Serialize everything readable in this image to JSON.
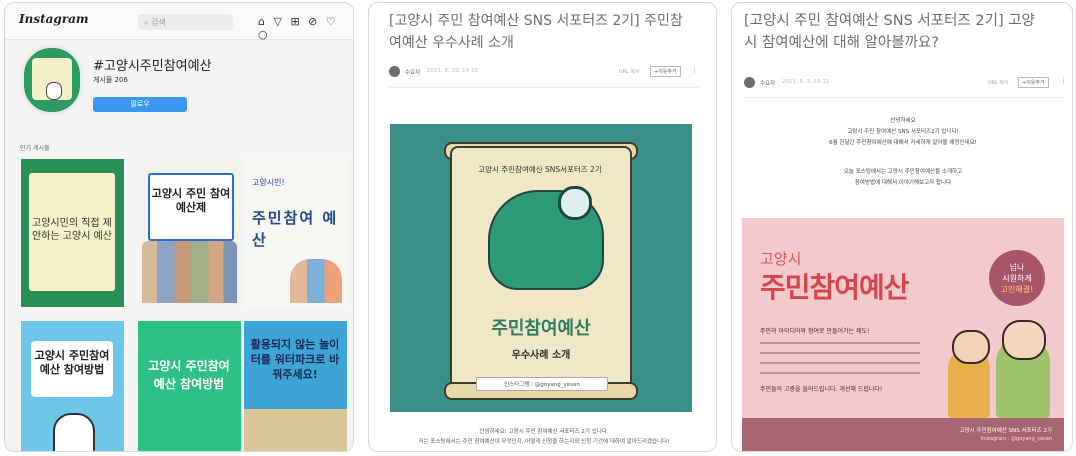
{
  "instagram": {
    "logo": "Instagram",
    "search_placeholder": "검색",
    "icons": [
      "home-icon",
      "send-icon",
      "add-icon",
      "explore-icon",
      "heart-icon",
      "profile-icon"
    ],
    "profile_name": "#고양시주민참여예산",
    "post_count": "게시물 206",
    "follow_label": "팔로우",
    "section_label": "인기 게시물",
    "tiles": [
      {
        "title": "고양시민의 직접 제안하는 고양시 예산"
      },
      {
        "title": "고양시 주민 참여 예산제"
      },
      {
        "top": "고양시민!",
        "title": "주민참여 예산"
      },
      {
        "title": "고양시 주민참여예산 참여방법"
      },
      {
        "title": "고양시 주민참여예산 참여방법"
      },
      {
        "title": "활용되지 않는 놀이터를 워터파크로 바꿔주세요!"
      }
    ]
  },
  "blog1": {
    "title": "[고양시 주민 참여예산 SNS 서포터즈 2기] 주민참여예산 우수사례 소개",
    "author": "수요자",
    "date": "2021. 8. 19. 14:33",
    "url_copy": "URL 복사",
    "neighbor_add": "+이웃추가",
    "poster_top": "고양시 주민참여예산 SNS서포터즈 2기",
    "poster_main": "주민참여예산",
    "poster_sub": "우수사례 소개",
    "poster_insta": "인스타그램 : @goyang_yesan",
    "caption_1": "안녕하세요! 고양시 주민 참여예산 서포터즈 2기 입니다.",
    "caption_2": "저는 포스팅에서는 주민 참여예산이 무엇인지, 어떻게 신청을 하는지와 신청 기간에 대하여 알아드리겠습니다!"
  },
  "blog2": {
    "title": "[고양시 주민 참여예산 SNS 서포터즈 2기] 고양시 참여예산에 대해 알아볼까요?",
    "author": "수요자",
    "date": "2021. 8. 3. 14:11",
    "url_copy": "URL 복사",
    "neighbor_add": "+이웃추가",
    "intro": [
      "안녕하세요",
      "고양시 주민 참여예산 SNS 서포터즈2기 입니다!",
      "6월 한달간 주민참여예산에 대해서 자세하게 알아볼 예정인데요!",
      "",
      "오늘 포스팅에서는 고양시 주민참여예산을 소개하고",
      "참여방법에 대해서 이야기해보고자 합니다"
    ],
    "poster_small": "고양시",
    "poster_big": "주민참여예산",
    "circle_1": "넘나",
    "circle_2": "시원하게",
    "circle_3": "고민해결!",
    "question": "주민의 아이디어와 참여로 만들어가는 제도!",
    "line_2": "주민들의 고충을 들어드립니다. 개선해 드립니다!",
    "foot_1": "고양시 주민참여예산 SNS 서포터즈 2기",
    "foot_2": "Instagram : @goyang_yesan"
  },
  "colors": {
    "instagram_blue": "#3897f0",
    "poster_teal": "#3c8f86",
    "poster_pink": "#f3c9cc",
    "title_red": "#d4464c"
  }
}
